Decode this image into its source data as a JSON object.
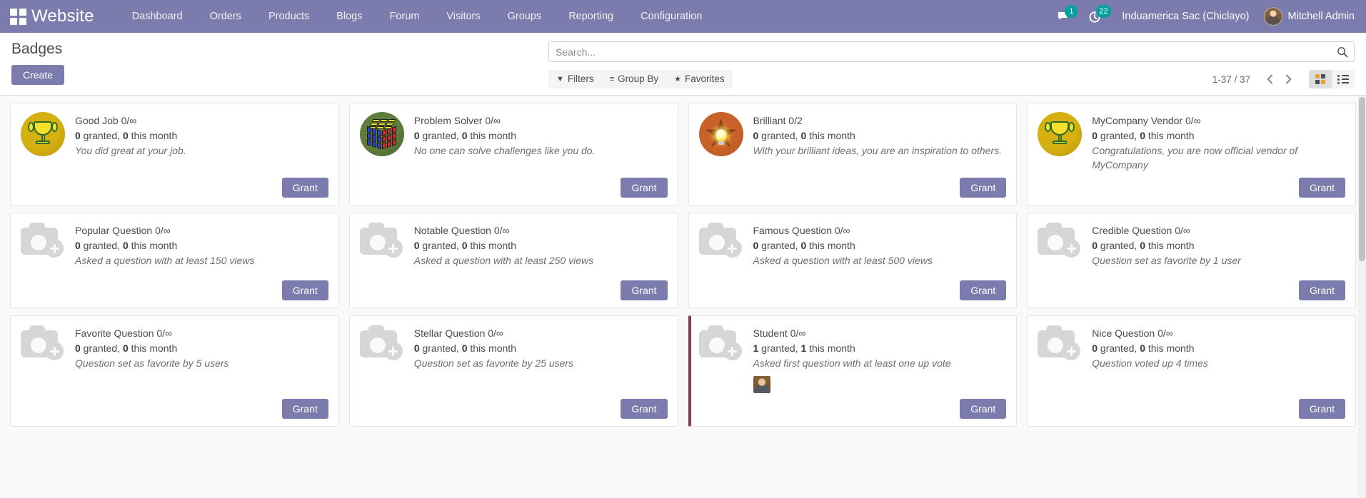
{
  "navbar": {
    "apps_icon": "apps-grid-icon",
    "brand": "Website",
    "menu_items": [
      {
        "label": "Dashboard"
      },
      {
        "label": "Orders"
      },
      {
        "label": "Products"
      },
      {
        "label": "Blogs"
      },
      {
        "label": "Forum"
      },
      {
        "label": "Visitors"
      },
      {
        "label": "Groups"
      },
      {
        "label": "Reporting"
      },
      {
        "label": "Configuration"
      }
    ],
    "messages_icon": "chat-bubble-icon",
    "messages_count": "1",
    "activities_icon": "clock-activity-icon",
    "activities_count": "22",
    "company": "Induamerica Sac (Chiclayo)",
    "user": "Mitchell Admin",
    "avatar_icon": "user-avatar",
    "background_color": "#7C7BAD",
    "badge_color": "#00A09D"
  },
  "control_panel": {
    "title": "Badges",
    "create_label": "Create",
    "search": {
      "placeholder": "Search...",
      "value": "",
      "icon": "search-icon"
    },
    "filters": [
      {
        "label": "Filters",
        "glyph": "▼",
        "icon": "filter-icon"
      },
      {
        "label": "Group By",
        "glyph": "≡",
        "icon": "group-by-icon"
      },
      {
        "label": "Favorites",
        "glyph": "★",
        "icon": "star-icon"
      }
    ],
    "pager": {
      "range": "1-37 / 37",
      "prev_icon": "chevron-left-icon",
      "next_icon": "chevron-right-icon"
    },
    "views": [
      {
        "name": "kanban",
        "icon": "kanban-view-icon",
        "active": true
      },
      {
        "name": "list",
        "icon": "list-view-icon",
        "active": false
      }
    ]
  },
  "kanban": {
    "grant_label": "Grant",
    "cards": [
      {
        "name": "Good Job 0/∞",
        "granted": "0",
        "granted_label": " granted, ",
        "month": "0",
        "month_label": " this month",
        "description": "You did great at your job.",
        "art": "trophy-gold",
        "highlighted": false,
        "owners": []
      },
      {
        "name": "Problem Solver 0/∞",
        "granted": "0",
        "granted_label": " granted, ",
        "month": "0",
        "month_label": " this month",
        "description": "No one can solve challenges like you do.",
        "art": "rubik-cube",
        "highlighted": false,
        "owners": []
      },
      {
        "name": "Brilliant 0/2",
        "granted": "0",
        "granted_label": " granted, ",
        "month": "0",
        "month_label": " this month",
        "description": "With your brilliant ideas, you are an inspiration to others.",
        "art": "star-lightbulb",
        "highlighted": false,
        "owners": []
      },
      {
        "name": "MyCompany Vendor 0/∞",
        "granted": "0",
        "granted_label": " granted, ",
        "month": "0",
        "month_label": " this month",
        "description": "Congratulations, you are now official vendor of MyCompany",
        "art": "trophy-gold",
        "highlighted": false,
        "owners": []
      },
      {
        "name": "Popular Question 0/∞",
        "granted": "0",
        "granted_label": " granted, ",
        "month": "0",
        "month_label": " this month",
        "description": "Asked a question with at least 150 views",
        "art": "image-placeholder",
        "highlighted": false,
        "owners": []
      },
      {
        "name": "Notable Question 0/∞",
        "granted": "0",
        "granted_label": " granted, ",
        "month": "0",
        "month_label": " this month",
        "description": "Asked a question with at least 250 views",
        "art": "image-placeholder",
        "highlighted": false,
        "owners": []
      },
      {
        "name": "Famous Question 0/∞",
        "granted": "0",
        "granted_label": " granted, ",
        "month": "0",
        "month_label": " this month",
        "description": "Asked a question with at least 500 views",
        "art": "image-placeholder",
        "highlighted": false,
        "owners": []
      },
      {
        "name": "Credible Question 0/∞",
        "granted": "0",
        "granted_label": " granted, ",
        "month": "0",
        "month_label": " this month",
        "description": "Question set as favorite by 1 user",
        "art": "image-placeholder",
        "highlighted": false,
        "owners": []
      },
      {
        "name": "Favorite Question 0/∞",
        "granted": "0",
        "granted_label": " granted, ",
        "month": "0",
        "month_label": " this month",
        "description": "Question set as favorite by 5 users",
        "art": "image-placeholder",
        "highlighted": false,
        "owners": []
      },
      {
        "name": "Stellar Question 0/∞",
        "granted": "0",
        "granted_label": " granted, ",
        "month": "0",
        "month_label": " this month",
        "description": "Question set as favorite by 25 users",
        "art": "image-placeholder",
        "highlighted": false,
        "owners": []
      },
      {
        "name": "Student 0/∞",
        "granted": "1",
        "granted_label": " granted, ",
        "month": "1",
        "month_label": " this month",
        "description": "Asked first question with at least one up vote",
        "art": "image-placeholder",
        "highlighted": true,
        "owners": [
          "owner-avatar"
        ]
      },
      {
        "name": "Nice Question 0/∞",
        "granted": "0",
        "granted_label": " granted, ",
        "month": "0",
        "month_label": " this month",
        "description": "Question voted up 4 times",
        "art": "image-placeholder",
        "highlighted": false,
        "owners": []
      }
    ]
  }
}
